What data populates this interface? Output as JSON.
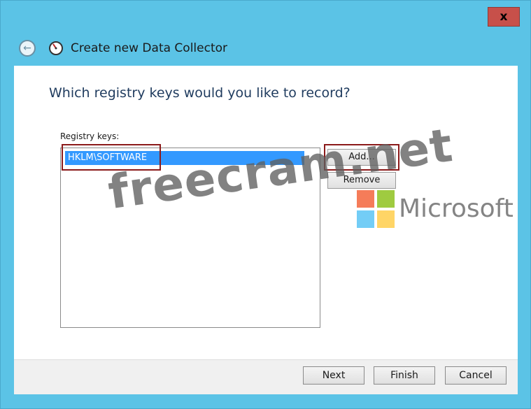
{
  "window": {
    "title": "Create new Data Collector",
    "close_label": "x",
    "back_icon": "back-arrow-icon",
    "collector_icon": "data-collector-icon"
  },
  "page": {
    "question": "Which registry keys would you like to record?",
    "list_label": "Registry keys:",
    "registry_keys": [
      "HKLM\\SOFTWARE"
    ],
    "selected_index": 0
  },
  "buttons": {
    "add": "Add...",
    "remove": "Remove",
    "next": "Next",
    "finish": "Finish",
    "cancel": "Cancel"
  },
  "watermark": {
    "text": "freecram.net",
    "brand": "Microsoft"
  },
  "colors": {
    "frame": "#5bc3e6",
    "selection": "#3399ff",
    "highlight_box": "#8b1a1a",
    "close_button": "#c7504a",
    "ms_red": "#f25022",
    "ms_green": "#7fba00",
    "ms_blue": "#00a4ef",
    "ms_yellow": "#ffb900"
  }
}
